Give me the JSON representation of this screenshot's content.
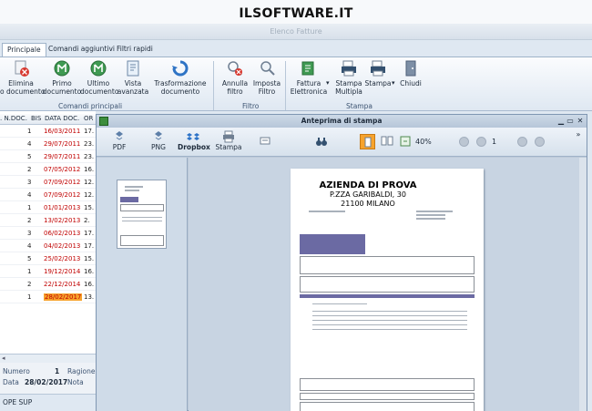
{
  "app": {
    "site_title": "ILSOFTWARE.IT",
    "window_title": "Elenco Fatture"
  },
  "ribbon": {
    "tabs": [
      "Principale",
      "Comandi aggiuntivi",
      "Filtri rapidi"
    ],
    "active_tab": "Principale",
    "buttons": {
      "elimina_l1": "Elimina",
      "elimina_l2": "o documento",
      "primo_l1": "Primo",
      "primo_l2": "documento",
      "ultimo_l1": "Ultimo",
      "ultimo_l2": "documento",
      "vista_l1": "Vista",
      "vista_l2": "avanzata",
      "trasf_l1": "Trasformazione",
      "trasf_l2": "documento",
      "annulla_l1": "Annulla",
      "annulla_l2": "filtro",
      "imposta_l1": "Imposta",
      "imposta_l2": "Filtro",
      "fattura_l1": "Fattura",
      "fattura_l2": "Elettronica",
      "stampa_multipla_l1": "Stampa",
      "stampa_multipla_l2": "Multipla",
      "stampa": "Stampa",
      "chiudi": "Chiudi"
    },
    "groups": {
      "comandi": "Comandi principali",
      "filtro": "Filtro",
      "stampa": "Stampa"
    }
  },
  "grid": {
    "headers": [
      ". N.DOC.",
      "BIS",
      "DATA DOC.",
      "OR"
    ],
    "rows": [
      {
        "num": "1",
        "date": "16/03/2011",
        "extra": "17."
      },
      {
        "num": "4",
        "date": "29/07/2011",
        "extra": "23."
      },
      {
        "num": "5",
        "date": "29/07/2011",
        "extra": "23."
      },
      {
        "num": "2",
        "date": "07/05/2012",
        "extra": "16."
      },
      {
        "num": "3",
        "date": "07/09/2012",
        "extra": "12."
      },
      {
        "num": "4",
        "date": "07/09/2012",
        "extra": "12."
      },
      {
        "num": "1",
        "date": "01/01/2013",
        "extra": "15."
      },
      {
        "num": "2",
        "date": "13/02/2013",
        "extra": "2."
      },
      {
        "num": "3",
        "date": "06/02/2013",
        "extra": "17."
      },
      {
        "num": "4",
        "date": "04/02/2013",
        "extra": "17."
      },
      {
        "num": "5",
        "date": "25/02/2013",
        "extra": "15."
      },
      {
        "num": "1",
        "date": "19/12/2014",
        "extra": "16."
      },
      {
        "num": "2",
        "date": "22/12/2014",
        "extra": "16."
      },
      {
        "num": "1",
        "date": "28/02/2017",
        "extra": "13."
      }
    ],
    "selected_date": "28/02/2017",
    "fields": {
      "numero_label": "Numero",
      "numero_value": "1",
      "ragione_label": "Ragione",
      "data_label": "Data",
      "data_value": "28/02/2017",
      "nota_label": "Nota"
    },
    "status": "OPE SUP"
  },
  "preview": {
    "title": "Anteprima di stampa",
    "toolbar": {
      "pdf": "PDF",
      "png": "PNG",
      "dropbox": "Dropbox",
      "stampa": "Stampa",
      "zoom": "40%",
      "page": "1"
    },
    "document": {
      "company": "AZIENDA DI PROVA",
      "address": "P.ZZA GARIBALDI, 30",
      "city": "21100 MILANO"
    }
  },
  "colors": {
    "accent_orange": "#f7a32c",
    "date_red": "#c00000",
    "doc_purple": "#6b6aa3"
  }
}
